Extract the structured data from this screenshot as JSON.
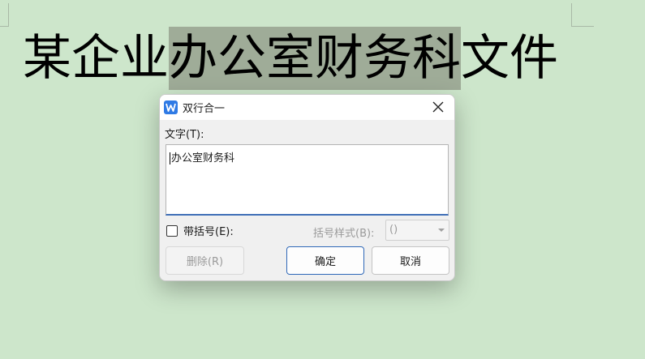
{
  "document": {
    "before_selection": "某企业",
    "selection": "办公室财务科",
    "after_selection": "文件"
  },
  "dialog": {
    "title": "双行合一",
    "app_icon": "wps-writer-icon",
    "text_label": "文字(T):",
    "text_value": "办公室财务科",
    "bracket_checkbox_label": "带括号(E):",
    "bracket_checked": false,
    "bracket_style_label": "括号样式(B):",
    "bracket_style_value": "()",
    "delete_button": "删除(R)",
    "ok_button": "确定",
    "cancel_button": "取消"
  },
  "colors": {
    "page_background": "#cde6cb",
    "selection_highlight": "#9fac98",
    "accent": "#2f68b8"
  }
}
